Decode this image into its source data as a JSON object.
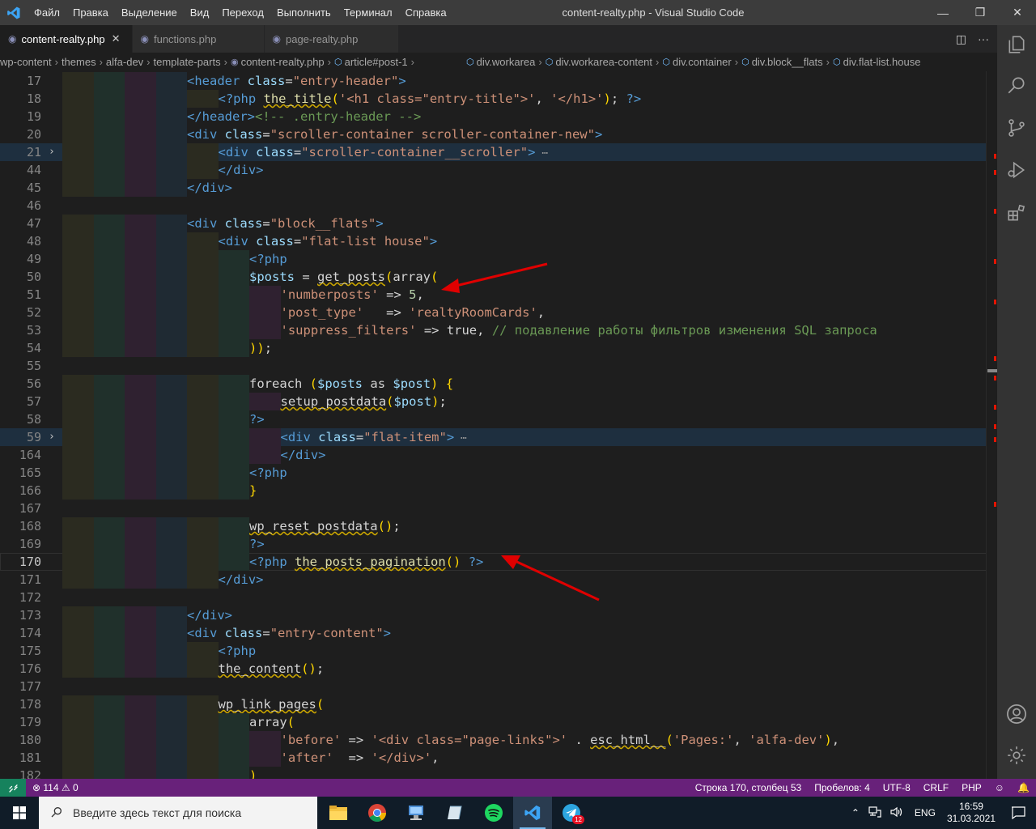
{
  "titlebar": {
    "menu": [
      "Файл",
      "Правка",
      "Выделение",
      "Вид",
      "Переход",
      "Выполнить",
      "Терминал",
      "Справка"
    ],
    "title": "content-realty.php - Visual Studio Code"
  },
  "tabs": [
    {
      "label": "content-realty.php",
      "active": true,
      "close": "✕"
    },
    {
      "label": "functions.php",
      "active": false
    },
    {
      "label": "page-realty.php",
      "active": false
    }
  ],
  "breadcrumb": [
    "wp-content",
    "themes",
    "alfa-dev",
    "template-parts",
    "content-realty.php",
    "article#post-1",
    "div.workarea",
    "div.workarea-content",
    "div.container",
    "div.block__flats",
    "div.flat-list.house"
  ],
  "editor": {
    "current_line": "170",
    "ellipsis": "⋯",
    "lines": [
      {
        "n": "17",
        "indent": 4,
        "code": "<header class=\"entry-header\">"
      },
      {
        "n": "18",
        "indent": 5,
        "code": "<?php the_title('<h1 class=\"entry-title\">', '</h1>'); ?>"
      },
      {
        "n": "19",
        "indent": 4,
        "code": "</header><!-- .entry-header -->"
      },
      {
        "n": "20",
        "indent": 4,
        "code": "<div class=\"scroller-container scroller-container-new\">"
      },
      {
        "n": "21",
        "indent": 5,
        "code": "<div class=\"scroller-container__scroller\">",
        "folded": true
      },
      {
        "n": "44",
        "indent": 5,
        "code": "</div>"
      },
      {
        "n": "45",
        "indent": 4,
        "code": "</div>"
      },
      {
        "n": "46",
        "indent": 0,
        "code": ""
      },
      {
        "n": "47",
        "indent": 4,
        "code": "<div class=\"block__flats\">"
      },
      {
        "n": "48",
        "indent": 5,
        "code": "<div class=\"flat-list house\">"
      },
      {
        "n": "49",
        "indent": 6,
        "code": "<?php"
      },
      {
        "n": "50",
        "indent": 6,
        "code": "$posts = get_posts(array("
      },
      {
        "n": "51",
        "indent": 7,
        "code": "'numberposts' => 5,"
      },
      {
        "n": "52",
        "indent": 7,
        "code": "'post_type'   => 'realtyRoomCards',"
      },
      {
        "n": "53",
        "indent": 7,
        "code": "'suppress_filters' => true, // подавление работы фильтров изменения SQL запроса"
      },
      {
        "n": "54",
        "indent": 6,
        "code": "));"
      },
      {
        "n": "55",
        "indent": 0,
        "code": ""
      },
      {
        "n": "56",
        "indent": 6,
        "code": "foreach ($posts as $post) {"
      },
      {
        "n": "57",
        "indent": 7,
        "code": "setup_postdata($post);"
      },
      {
        "n": "58",
        "indent": 6,
        "code": "?>"
      },
      {
        "n": "59",
        "indent": 7,
        "code": "<div class=\"flat-item\">",
        "folded": true
      },
      {
        "n": "164",
        "indent": 7,
        "code": "</div>"
      },
      {
        "n": "165",
        "indent": 6,
        "code": "<?php"
      },
      {
        "n": "166",
        "indent": 6,
        "code": "}"
      },
      {
        "n": "167",
        "indent": 0,
        "code": ""
      },
      {
        "n": "168",
        "indent": 6,
        "code": "wp_reset_postdata();"
      },
      {
        "n": "169",
        "indent": 6,
        "code": "?>"
      },
      {
        "n": "170",
        "indent": 6,
        "code": "<?php the_posts_pagination() ?>"
      },
      {
        "n": "171",
        "indent": 5,
        "code": "</div>"
      },
      {
        "n": "172",
        "indent": 0,
        "code": ""
      },
      {
        "n": "173",
        "indent": 4,
        "code": "</div>"
      },
      {
        "n": "174",
        "indent": 4,
        "code": "<div class=\"entry-content\">"
      },
      {
        "n": "175",
        "indent": 5,
        "code": "<?php"
      },
      {
        "n": "176",
        "indent": 5,
        "code": "the_content();"
      },
      {
        "n": "177",
        "indent": 0,
        "code": ""
      },
      {
        "n": "178",
        "indent": 5,
        "code": "wp_link_pages("
      },
      {
        "n": "179",
        "indent": 6,
        "code": "array("
      },
      {
        "n": "180",
        "indent": 7,
        "code": "'before' => '<div class=\"page-links\">' . esc_html__('Pages:', 'alfa-dev'),"
      },
      {
        "n": "181",
        "indent": 7,
        "code": "'after'  => '</div>',"
      },
      {
        "n": "182",
        "indent": 6,
        "code": ")"
      }
    ]
  },
  "statusbar": {
    "problems": "⊗ 114 ⚠ 0",
    "position": "Строка 170, столбец 53",
    "spaces": "Пробелов: 4",
    "encoding": "UTF-8",
    "eol": "CRLF",
    "language": "PHP"
  },
  "taskbar": {
    "search_placeholder": "Введите здесь текст для поиска",
    "lang": "ENG",
    "time": "16:59",
    "date": "31.03.2021",
    "badge": "12"
  },
  "colors": {
    "statusbar": "#68217a",
    "remote": "#16825d",
    "annotation_arrow": "#e00000"
  }
}
